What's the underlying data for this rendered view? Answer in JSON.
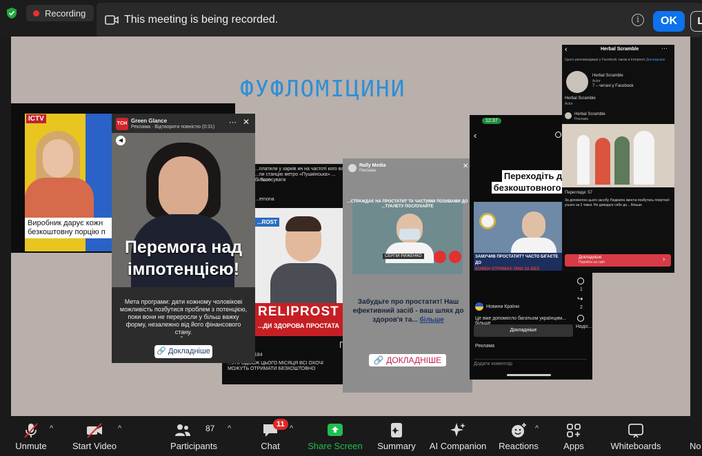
{
  "topbar": {
    "recording_label": "Recording",
    "banner_message": "This meeting is being recorded.",
    "info_glyph": "i",
    "ok_label": "OK",
    "side_label": "L"
  },
  "slide": {
    "title": "ФУФЛОМІЦИНИ",
    "cards": {
      "ictv": {
        "logo": "ICTV",
        "caption_line1": "Виробник дарує кожн",
        "caption_line2": "безкоштовну порцію п"
      },
      "green_glance": {
        "channel": "TCH",
        "name": "Green Glance",
        "meta": "Реклама · Відтворити повністю (0:31)",
        "overlay_line1": "Перемога над",
        "overlay_line2": "імпотенцією!",
        "body": "Мета програми: дати кожному чоловікові можливість позбутися проблем з потенцією, поки вони не переросли у більш важку форму, незалежно від його фінансового стану.",
        "cta": "Докладніше"
      },
      "reliprost": {
        "top_text": "...платили у харків ин на частоті кого варто ...пи станцію метро «Пушкінська» ... більше",
        "menu": "... Голосувати",
        "account": "...ernona",
        "badge": "...ROST",
        "brand": "Reliprost",
        "subtitle": "...ДИ ЗДОРОВА ПРОСТАТА",
        "views": "Перегляди: 184",
        "footer": "...УПРОДОВЖ ЦЬОГО МІСЯЦЯ ВСІ ОХОЧІ МОЖУТЬ ОТРИМАТИ БЕЗКОШТОВНО"
      },
      "rally": {
        "name": "Rally Media",
        "meta": "Реклама",
        "banner": "...СТРАЖДАЄ НА ПРОСТАТИТ ТА ЧАСТИМИ ПОЗИВАМИ ДО ...ТУАЛЕТУ ПОСЛУХАЙТЕ",
        "doctor": "СЕРГІЙ РИЖЕНКО",
        "body": "Забудьте про простатит! Наш ефективний засіб - ваш шлях до здоров'я та...",
        "more": "більше",
        "cta": "ДОКЛАДНІШЕ"
      },
      "novyny": {
        "time": "12:37",
        "headline_line1": "Переходіть до",
        "headline_line2": "безкоштовного чат",
        "banner_line1": "ЗАМУЧИВ ПРОСТАТИТ? ЧАСТО БІГАЄТЕ ДО",
        "banner_line2": "КОЖЕН ОТРИМАЄ ЛІКИ ЗА БЕЗ",
        "like_count": "1",
        "share_count": "2",
        "more_label": "Надіс...",
        "account": "Новини Країни",
        "text": "Це вже допомогло багатьом українцям... більше",
        "cta": "Докладніше",
        "sponsored": "Реклама",
        "comment_placeholder": "Додати коментар"
      },
      "herbal": {
        "header": "Herbal Scramble",
        "notice": "Цього рекламодавця у Facebook також в інтернеті",
        "notice_link": "Докладніше",
        "profile_name": "Herbal Scramble",
        "profile_role": "Actor",
        "profile_followers": "7 – читачі у Facebook",
        "name2": "Herbal Scramble",
        "role2": "Actor",
        "post_name": "Herbal Scramble",
        "post_meta": "Реклама",
        "views": "Перегляди: 57",
        "text": "За допомогою цього засобу Людмила змогла позбутись гіпертонії усього за 2 тижні. Не доводьте себе до... більше",
        "cta": "Докладніше",
        "cta_sub": "Перейти на сайт"
      }
    }
  },
  "toolbar": {
    "items": [
      {
        "label": "Unmute",
        "icon": "microphone-muted-icon"
      },
      {
        "label": "Start Video",
        "icon": "video-off-icon"
      },
      {
        "label": "Participants",
        "icon": "people-icon",
        "count": "87"
      },
      {
        "label": "Chat",
        "icon": "chat-icon",
        "badge": "11"
      },
      {
        "label": "Share Screen",
        "icon": "share-screen-icon"
      },
      {
        "label": "Summary",
        "icon": "summary-icon"
      },
      {
        "label": "AI Companion",
        "icon": "sparkle-icon"
      },
      {
        "label": "Reactions",
        "icon": "emoji-icon"
      },
      {
        "label": "Apps",
        "icon": "apps-icon"
      },
      {
        "label": "Whiteboards",
        "icon": "whiteboard-icon"
      },
      {
        "label": "No",
        "icon": "notes-icon"
      }
    ],
    "colors": {
      "share_green": "#1fbf4f",
      "accent_blue": "#0e72ed",
      "badge_red": "#e02828"
    }
  }
}
